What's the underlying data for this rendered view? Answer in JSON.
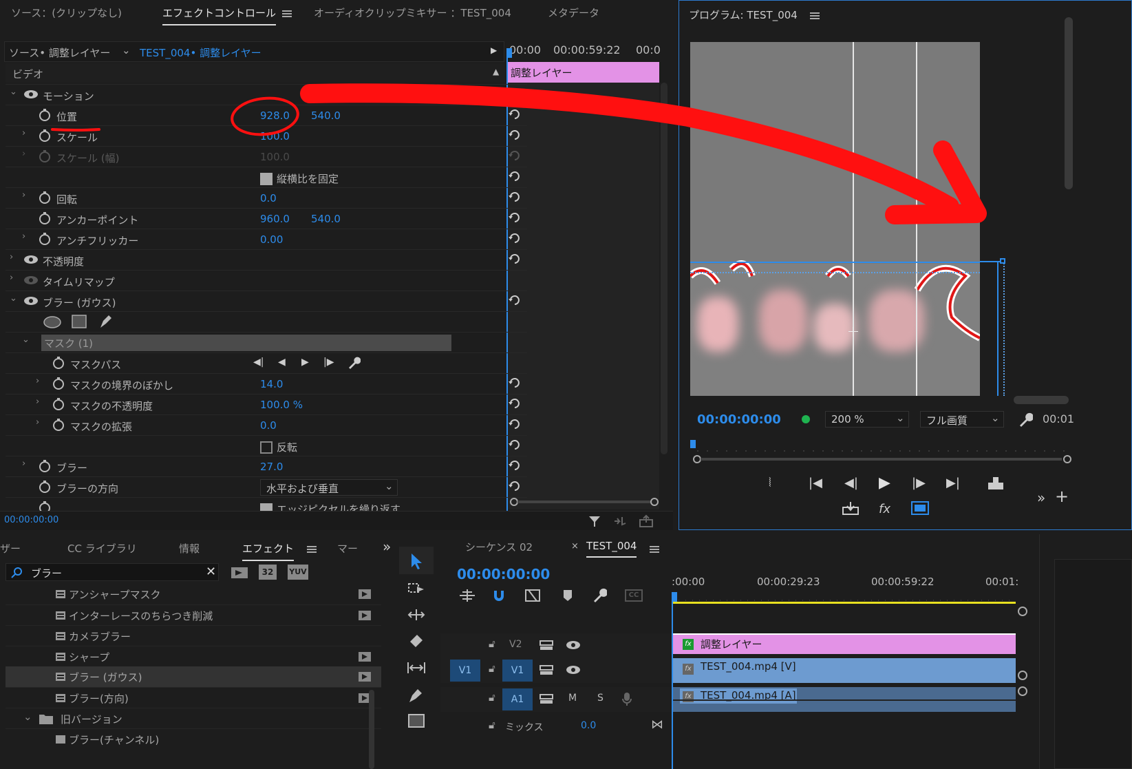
{
  "colors": {
    "accent": "#2d8ceb",
    "clip_adjust": "#e392e6",
    "clip_video": "#6d9bd0",
    "annotation": "#ff1010",
    "play_head": "#2d8ceb"
  },
  "top_tabs": {
    "source": "ソース：(クリップなし)",
    "effect_controls": "エフェクトコントロール",
    "audio_mixer": "オーディオクリップミキサー ：TEST_004",
    "metadata": "メタデータ"
  },
  "effect_controls": {
    "source_label": "ソース• 調整レイヤー",
    "sequence_label": "TEST_004• 調整レイヤー",
    "ruler": [
      "00:00",
      "00:00:59:22",
      "00:0"
    ],
    "clip_label": "調整レイヤー",
    "section_video": "ビデオ",
    "motion": "モーション",
    "position": {
      "label": "位置",
      "x": "928.0",
      "y": "540.0"
    },
    "scale": {
      "label": "スケール",
      "value": "100.0"
    },
    "scale_width": {
      "label": "スケール (幅)",
      "value": "100.0"
    },
    "uniform_scale": "縦横比を固定",
    "rotation": {
      "label": "回転",
      "value": "0.0"
    },
    "anchor": {
      "label": "アンカーポイント",
      "x": "960.0",
      "y": "540.0"
    },
    "anti_flicker": {
      "label": "アンチフリッカー",
      "value": "0.00"
    },
    "opacity": "不透明度",
    "time_remap": "タイムリマップ",
    "gaussian_blur": "ブラー (ガウス)",
    "mask": "マスク (1)",
    "mask_path": "マスクパス",
    "mask_feather": {
      "label": "マスクの境界のぼかし",
      "value": "14.0"
    },
    "mask_opacity": {
      "label": "マスクの不透明度",
      "value": "100.0 %"
    },
    "mask_expansion": {
      "label": "マスクの拡張",
      "value": "0.0"
    },
    "inverted": "反転",
    "blurriness": {
      "label": "ブラー",
      "value": "27.0"
    },
    "blur_dimensions": {
      "label": "ブラーの方向",
      "value": "水平および垂直"
    },
    "repeat_edge": "エッジピクセルを繰り返す",
    "timecode": "00:00:00:00"
  },
  "program": {
    "title": "プログラム: TEST_004",
    "timecode": "00:00:00:00",
    "zoom": "200 %",
    "quality": "フル画質",
    "duration_partial": "00:01"
  },
  "effects_panel": {
    "tabs": [
      "ザー",
      "CC ライブラリ",
      "情報",
      "エフェクト",
      "マー"
    ],
    "search_value": "ブラー",
    "badge_32": "32",
    "badge_yuv": "YUV",
    "items": [
      {
        "label": "アンシャープマスク",
        "accel": true
      },
      {
        "label": "インターレースのちらつき削減",
        "accel": true
      },
      {
        "label": "カメラブラー",
        "accel": false
      },
      {
        "label": "シャープ",
        "accel": true
      },
      {
        "label": "ブラー (ガウス)",
        "accel": true
      },
      {
        "label": "ブラー(方向)",
        "accel": true
      }
    ],
    "folder": "旧バージョン",
    "folder_child": "ブラー(チャンネル)"
  },
  "timeline": {
    "tab_inactive": "シーケンス 02",
    "tab_active": "TEST_004",
    "timecode": "00:00:00:00",
    "ruler": [
      ":00:00",
      "00:00:29:23",
      "00:00:59:22",
      "00:01:"
    ],
    "tracks": {
      "v2": "V2",
      "v1_src": "V1",
      "v1": "V1",
      "a1": "A1",
      "m": "M",
      "s": "S",
      "mix": "ミックス",
      "mix_value": "0.0"
    },
    "clips": {
      "adjust": "調整レイヤー",
      "video": "TEST_004.mp4 [V]",
      "audio": "TEST_004.mp4 [A]"
    }
  }
}
